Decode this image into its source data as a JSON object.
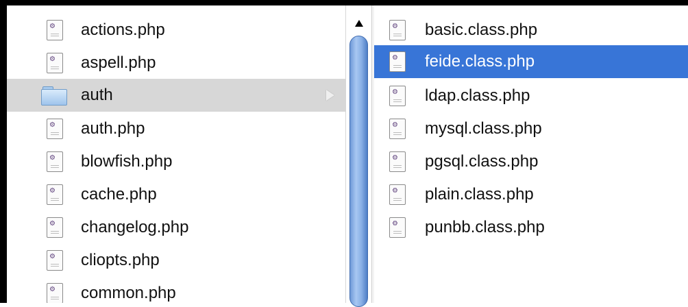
{
  "left_column": {
    "items": [
      {
        "label": "actions.php",
        "type": "file",
        "icon": "php-file-icon"
      },
      {
        "label": "aspell.php",
        "type": "file",
        "icon": "php-file-icon"
      },
      {
        "label": "auth",
        "type": "folder",
        "icon": "folder-icon",
        "state": "open"
      },
      {
        "label": "auth.php",
        "type": "file",
        "icon": "php-file-icon"
      },
      {
        "label": "blowfish.php",
        "type": "file",
        "icon": "php-file-icon"
      },
      {
        "label": "cache.php",
        "type": "file",
        "icon": "php-file-icon"
      },
      {
        "label": "changelog.php",
        "type": "file",
        "icon": "php-file-icon"
      },
      {
        "label": "cliopts.php",
        "type": "file",
        "icon": "php-file-icon"
      },
      {
        "label": "common.php",
        "type": "file",
        "icon": "php-file-icon"
      }
    ]
  },
  "right_column": {
    "items": [
      {
        "label": "basic.class.php",
        "type": "file",
        "icon": "php-file-icon"
      },
      {
        "label": "feide.class.php",
        "type": "file",
        "icon": "php-file-icon",
        "state": "selected"
      },
      {
        "label": "ldap.class.php",
        "type": "file",
        "icon": "php-file-icon"
      },
      {
        "label": "mysql.class.php",
        "type": "file",
        "icon": "php-file-icon"
      },
      {
        "label": "pgsql.class.php",
        "type": "file",
        "icon": "php-file-icon"
      },
      {
        "label": "plain.class.php",
        "type": "file",
        "icon": "php-file-icon"
      },
      {
        "label": "punbb.class.php",
        "type": "file",
        "icon": "php-file-icon"
      }
    ]
  },
  "colors": {
    "selection": "#3875d7",
    "folder_highlight": "#d7d7d7",
    "scroll_thumb": "#8ab1e6"
  }
}
